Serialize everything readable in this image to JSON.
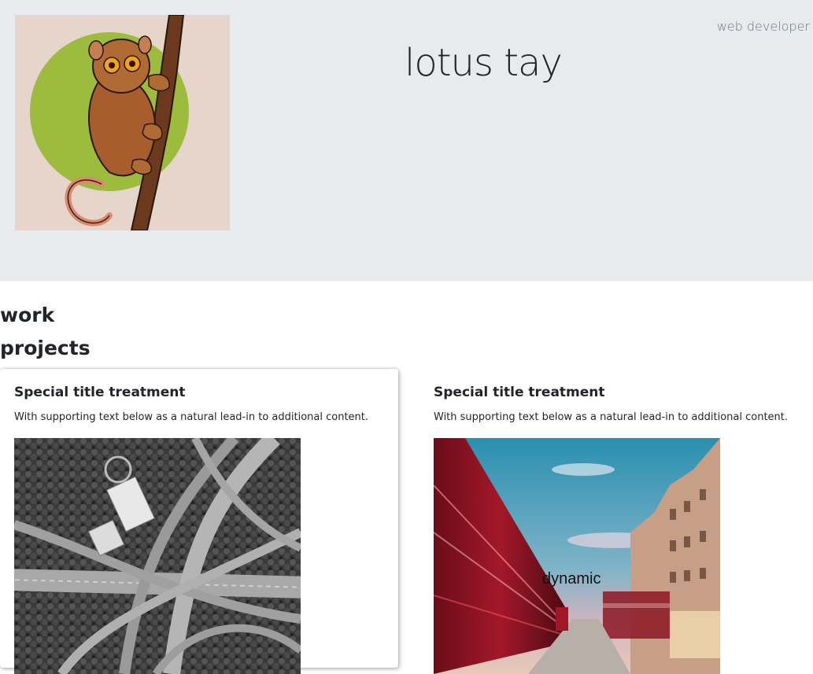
{
  "header": {
    "name": "lotus tay",
    "role": "web developer",
    "avatar_icon": "tarsier-illustration-icon"
  },
  "sections": {
    "work": "work",
    "projects": "projects"
  },
  "cards": [
    {
      "title": "Special title treatment",
      "text": "With supporting text below as a natural lead-in to additional content.",
      "image_icon": "highway-interchange-photo-icon"
    },
    {
      "title": "Special title treatment",
      "text": "With supporting text below as a natural lead-in to additional content.",
      "image_icon": "london-street-bus-photo-icon",
      "overlay": "dynamic"
    }
  ],
  "colors": {
    "hero_bg": "#e8ebee",
    "avatar_bg": "#e6d5cb",
    "circle_green": "#9dbb3c"
  }
}
